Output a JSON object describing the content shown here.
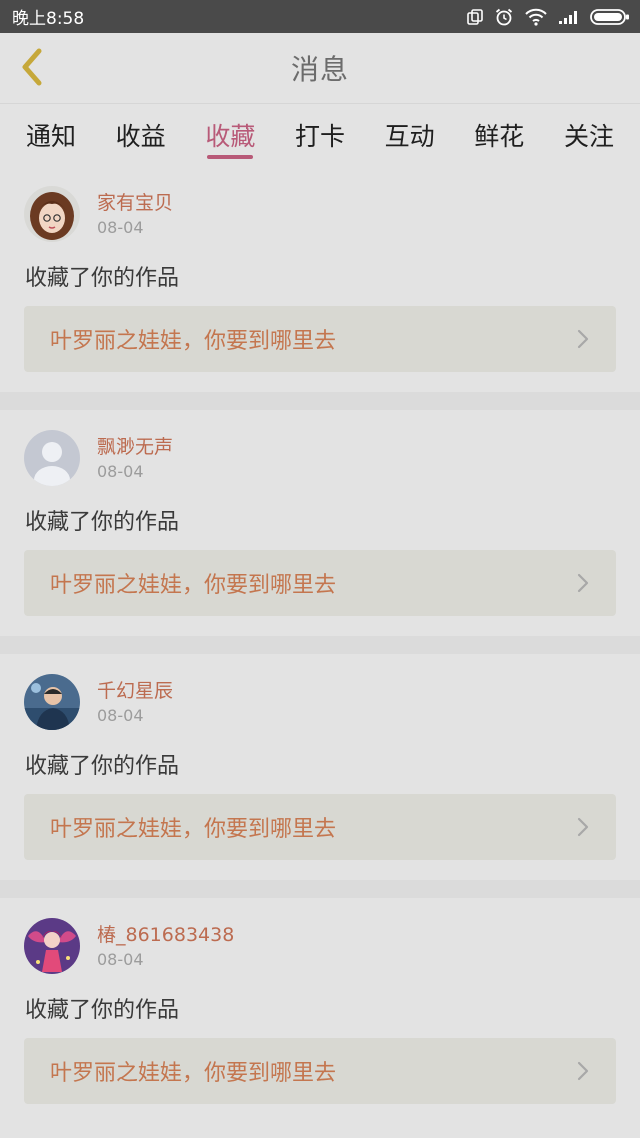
{
  "status_bar": {
    "time": "晚上8:58"
  },
  "header": {
    "title": "消息"
  },
  "tabs": [
    {
      "label": "通知",
      "active": false
    },
    {
      "label": "收益",
      "active": false
    },
    {
      "label": "收藏",
      "active": true
    },
    {
      "label": "打卡",
      "active": false
    },
    {
      "label": "互动",
      "active": false
    },
    {
      "label": "鲜花",
      "active": false
    },
    {
      "label": "关注",
      "active": false
    }
  ],
  "messages": [
    {
      "username": "家有宝贝",
      "date": "08-04",
      "action": "收藏了你的作品",
      "work_title": "叶罗丽之娃娃，你要到哪里去"
    },
    {
      "username": "飘渺无声",
      "date": "08-04",
      "action": "收藏了你的作品",
      "work_title": "叶罗丽之娃娃，你要到哪里去"
    },
    {
      "username": "千幻星辰",
      "date": "08-04",
      "action": "收藏了你的作品",
      "work_title": "叶罗丽之娃娃，你要到哪里去"
    },
    {
      "username": "椿_861683438",
      "date": "08-04",
      "action": "收藏了你的作品",
      "work_title": "叶罗丽之娃娃，你要到哪里去"
    }
  ],
  "colors": {
    "accent": "#b85a78",
    "username": "#bc6b50",
    "back_arrow": "#c6a83a"
  }
}
